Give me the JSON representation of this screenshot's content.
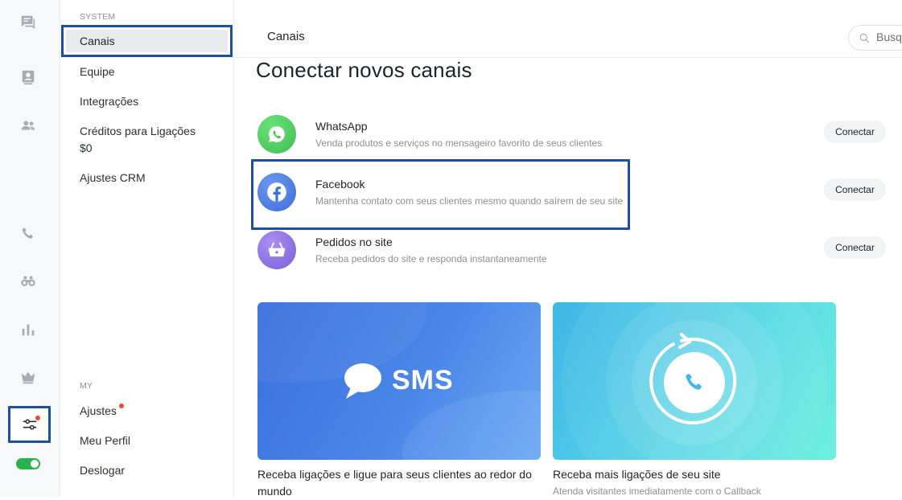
{
  "rail": {
    "icons": [
      "chat-icon",
      "contact-card-icon",
      "team-icon",
      "phone-icon",
      "binoculars-icon",
      "bar-chart-icon",
      "crown-icon",
      "settings-sliders-icon"
    ],
    "toggle_on": true,
    "settings_notification": true,
    "colors": {
      "icon": "#a7adb6",
      "toggle": "#27b34c",
      "notification": "#f5453c",
      "highlight": "#1b4fa3"
    }
  },
  "menu": {
    "system_label": "SYSTEM",
    "items": [
      {
        "label": "Canais",
        "active": true
      },
      {
        "label": "Equipe"
      },
      {
        "label": "Integrações"
      },
      {
        "label": "Créditos para Ligações"
      },
      {
        "label": "Ajustes CRM"
      }
    ],
    "credits_value": "$0",
    "my_label": "MY",
    "my_items": [
      {
        "label": "Ajustes",
        "badge": true
      },
      {
        "label": "Meu Perfil"
      },
      {
        "label": "Deslogar"
      }
    ]
  },
  "header": {
    "title": "Canais",
    "search_placeholder": "Busq"
  },
  "main": {
    "heading": "Conectar novos canais",
    "channels": [
      {
        "name": "WhatsApp",
        "description": "Venda produtos e serviços no mensageiro favorito de seus clientes",
        "button": "Conectar",
        "icon": "whatsapp-icon",
        "color": "#4ccb5a"
      },
      {
        "name": "Facebook",
        "description": "Mantenha contato com seus clientes mesmo quando saírem de seu site",
        "button": "Conectar",
        "icon": "facebook-icon",
        "color": "#3b6fd9",
        "highlighted": true
      },
      {
        "name": "Pedidos no site",
        "description": "Receba pedidos do site e responda instantaneamente",
        "button": "Conectar",
        "icon": "shopping-basket-icon",
        "color": "#8c6ee0"
      }
    ],
    "promos": [
      {
        "banner_text": "SMS",
        "caption": "Receba ligações e ligue para seus clientes ao redor do mundo",
        "icon": "chat-bubble-icon"
      },
      {
        "caption": "Receba mais ligações de seu site",
        "subcaption": "Atenda visitantes imediatamente com o Callback",
        "icon": "phone-callback-icon"
      }
    ]
  }
}
